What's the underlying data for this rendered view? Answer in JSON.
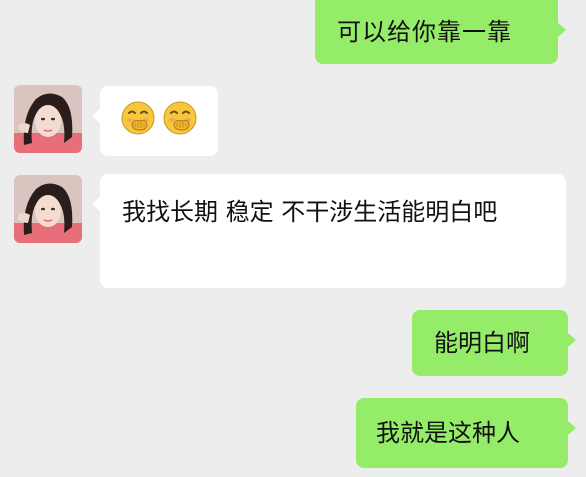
{
  "messages": [
    {
      "sender": "me",
      "text": "可以给你靠一靠"
    },
    {
      "sender": "other",
      "emojis": [
        "smirk-hand-over-mouth-emoji",
        "smirk-hand-over-mouth-emoji"
      ]
    },
    {
      "sender": "other",
      "text": "我找长期 稳定 不干涉生活能明白吧"
    },
    {
      "sender": "me",
      "text": "能明白啊"
    },
    {
      "sender": "me",
      "text": "我就是这种人"
    }
  ],
  "colors": {
    "background": "#ededed",
    "me_bubble": "#95ec69",
    "other_bubble": "#ffffff"
  }
}
